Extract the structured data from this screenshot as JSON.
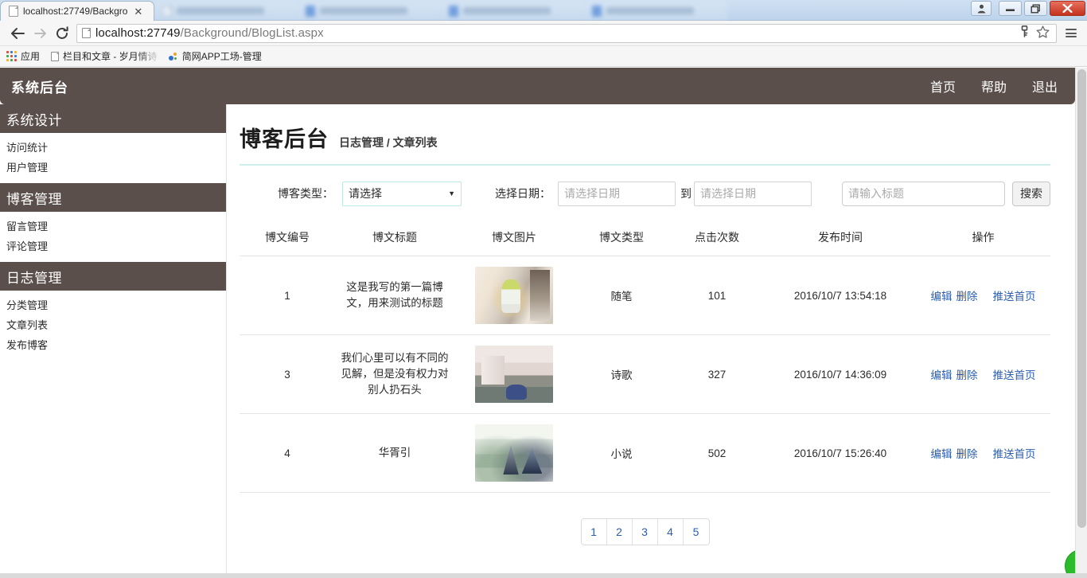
{
  "browser": {
    "tabs": [
      {
        "title": "localhost:27749/Backgro",
        "active": true,
        "favicon": "page-icon",
        "close_label": "✕"
      },
      {
        "title": "",
        "active": false,
        "favicon": "page-icon"
      },
      {
        "title": "",
        "active": false,
        "favicon": "blue-icon"
      },
      {
        "title": "",
        "active": false,
        "favicon": "blue-icon"
      },
      {
        "title": "",
        "active": false,
        "favicon": "blue-icon"
      }
    ],
    "window_controls": {
      "profile": "P",
      "minimize": "–",
      "restore": "❐",
      "close": "✕"
    },
    "toolbar": {
      "back": "←",
      "forward": "→",
      "reload": "↻",
      "url_host": "localhost:27749",
      "url_path": "/Background/BlogList.aspx",
      "key_icon": "⚷",
      "star_icon": "☆"
    },
    "bookmarks": [
      {
        "label": "应用",
        "icon": "apps-grid-icon"
      },
      {
        "label": "栏目和文章 - 岁月情诗",
        "icon": "page-icon"
      },
      {
        "label": "简网APP工场-管理",
        "icon": "dots-icon"
      }
    ]
  },
  "app": {
    "brand": "系统后台",
    "nav": [
      {
        "label": "首页"
      },
      {
        "label": "帮助"
      },
      {
        "label": "退出"
      }
    ]
  },
  "sidebar": {
    "groups": [
      {
        "title": "系统设计",
        "items": [
          {
            "label": "访问统计"
          },
          {
            "label": "用户管理"
          }
        ]
      },
      {
        "title": "博客管理",
        "items": [
          {
            "label": "留言管理"
          },
          {
            "label": "评论管理"
          }
        ]
      },
      {
        "title": "日志管理",
        "items": [
          {
            "label": "分类管理"
          },
          {
            "label": "文章列表"
          },
          {
            "label": "发布博客"
          }
        ]
      }
    ]
  },
  "page": {
    "title": "博客后台",
    "breadcrumb": "日志管理 / 文章列表"
  },
  "filters": {
    "type_label": "博客类型：",
    "type_value": "请选择",
    "type_caret": "▼",
    "date_label": "选择日期：",
    "date_from_placeholder": "请选择日期",
    "date_to_label": "到",
    "date_to_placeholder": "请选择日期",
    "search_placeholder": "请输入标题",
    "search_button": "搜索"
  },
  "table": {
    "headers": [
      "博文编号",
      "博文标题",
      "博文图片",
      "博文类型",
      "点击次数",
      "发布时间",
      "操作"
    ],
    "rows": [
      {
        "id": "1",
        "title": "这是我写的第一篇博文，用来测试的标题",
        "image": "child-in-room-photo",
        "type": "随笔",
        "clicks": "101",
        "time": "2016/10/7 13:54:18",
        "ops": {
          "edit": "编辑",
          "delete": "删除",
          "push": "推送首页"
        }
      },
      {
        "id": "3",
        "title": "我们心里可以有不同的见解，但是没有权力对别人扔石头",
        "image": "interior-room-photo",
        "type": "诗歌",
        "clicks": "327",
        "time": "2016/10/7 14:36:09",
        "ops": {
          "edit": "编辑",
          "delete": "删除",
          "push": "推送首页"
        }
      },
      {
        "id": "4",
        "title": "华胥引",
        "image": "ink-mountain-painting",
        "type": "小说",
        "clicks": "502",
        "time": "2016/10/7 15:26:40",
        "ops": {
          "edit": "编辑",
          "delete": "删除",
          "push": "推送首页"
        }
      }
    ]
  },
  "pagination": {
    "pages": [
      "1",
      "2",
      "3",
      "4",
      "5"
    ]
  },
  "colors": {
    "appbar": "#5a4f4b",
    "link": "#2a5db0",
    "divider_teal": "#cdeeea",
    "select_border": "#bfe7e4",
    "bubble_green": "#2bbb2b"
  }
}
